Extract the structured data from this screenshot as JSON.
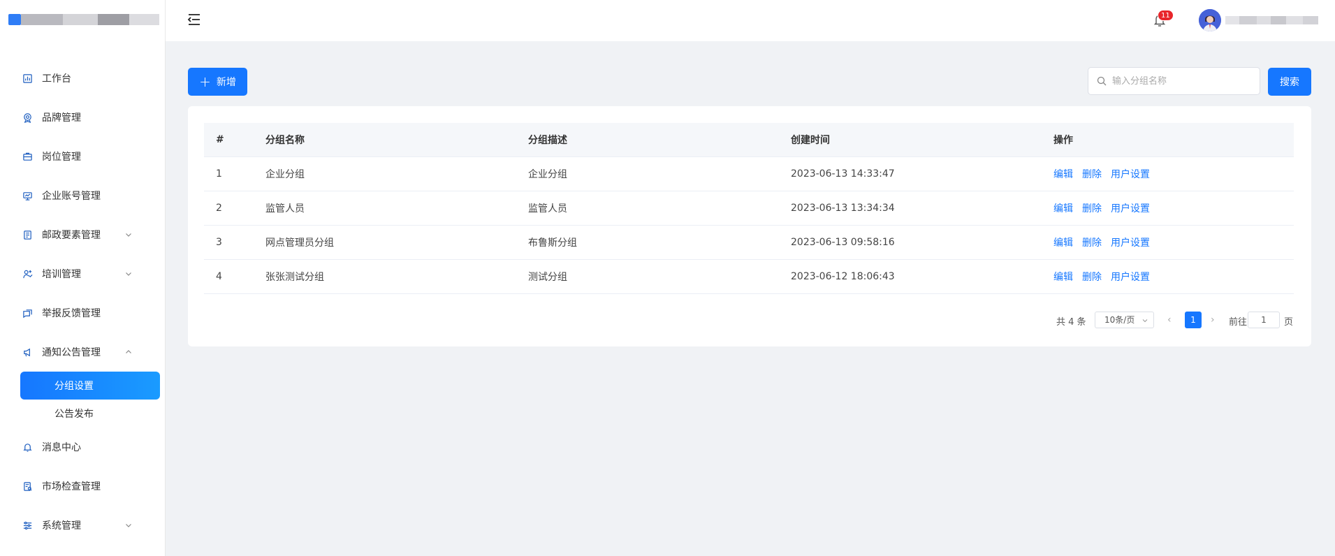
{
  "sidebar": {
    "items": [
      {
        "label": "工作台",
        "icon": "dashboard-icon"
      },
      {
        "label": "品牌管理",
        "icon": "brand-icon"
      },
      {
        "label": "岗位管理",
        "icon": "position-icon"
      },
      {
        "label": "企业账号管理",
        "icon": "monitor-icon"
      },
      {
        "label": "邮政要素管理",
        "icon": "document-icon",
        "expandable": true
      },
      {
        "label": "培训管理",
        "icon": "training-icon",
        "expandable": true
      },
      {
        "label": "举报反馈管理",
        "icon": "feedback-icon"
      },
      {
        "label": "通知公告管理",
        "icon": "announcement-icon",
        "expanded": true
      }
    ],
    "subitems": [
      {
        "label": "分组设置",
        "active": true
      },
      {
        "label": "公告发布",
        "active": false
      }
    ],
    "items_after": [
      {
        "label": "消息中心",
        "icon": "bell-icon"
      },
      {
        "label": "市场检查管理",
        "icon": "inspection-icon"
      },
      {
        "label": "系统管理",
        "icon": "settings-icon",
        "expandable": true
      }
    ]
  },
  "header": {
    "notification_count": "11"
  },
  "toolbar": {
    "add_label": "新增",
    "search_placeholder": "输入分组名称",
    "search_label": "搜索"
  },
  "table": {
    "columns": [
      "#",
      "分组名称",
      "分组描述",
      "创建时间",
      "操作"
    ],
    "rows": [
      {
        "idx": "1",
        "name": "企业分组",
        "desc": "企业分组",
        "time": "2023-06-13 14:33:47"
      },
      {
        "idx": "2",
        "name": "监管人员",
        "desc": "监管人员",
        "time": "2023-06-13 13:34:34"
      },
      {
        "idx": "3",
        "name": "网点管理员分组",
        "desc": "布鲁斯分组",
        "time": "2023-06-13 09:58:16"
      },
      {
        "idx": "4",
        "name": "张张测试分组",
        "desc": "测试分组",
        "time": "2023-06-12 18:06:43"
      }
    ],
    "actions": {
      "edit": "编辑",
      "delete": "删除",
      "user_settings": "用户设置"
    }
  },
  "pagination": {
    "total": "共 4 条",
    "page_size": "10条/页",
    "current_page": "1",
    "goto_label": "前往",
    "goto_value": "1",
    "page_suffix": "页"
  },
  "colors": {
    "primary": "#1677ff",
    "badge": "#e8262b"
  }
}
